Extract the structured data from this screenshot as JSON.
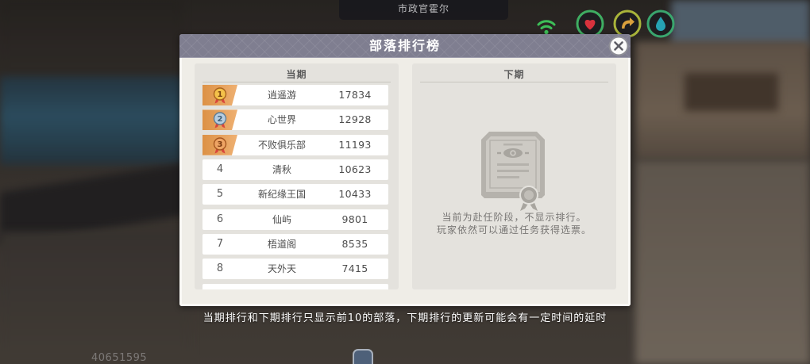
{
  "hud": {
    "npc_label": "市政官霍尔",
    "player_id": "40651595",
    "status_icons": [
      "signal-icon",
      "heart-icon",
      "arrow-icon",
      "water-drop-icon"
    ],
    "bottom_button_icon": "menu-badge-icon"
  },
  "dialog": {
    "title": "部落排行榜",
    "close_icon": "close-icon",
    "current": {
      "header": "当期",
      "rows": [
        {
          "rank": 1,
          "name": "逍遥游",
          "score": 17834
        },
        {
          "rank": 2,
          "name": "心世界",
          "score": 12928
        },
        {
          "rank": 3,
          "name": "不败俱乐部",
          "score": 11193
        },
        {
          "rank": 4,
          "name": "清秋",
          "score": 10623
        },
        {
          "rank": 5,
          "name": "新纪缘王国",
          "score": 10433
        },
        {
          "rank": 6,
          "name": "仙屿",
          "score": 9801
        },
        {
          "rank": 7,
          "name": "梧道阁",
          "score": 8535
        },
        {
          "rank": 8,
          "name": "天外天",
          "score": 7415
        }
      ]
    },
    "next": {
      "header": "下期",
      "empty_icon": "certificate-icon",
      "message": [
        "当前为赴任阶段，不显示排行。",
        "玩家依然可以通过任务获得选票。"
      ]
    }
  },
  "footnote": "当期排行和下期排行只显示前10的部落，下期排行的更新可能会有一定时间的延时",
  "colors": {
    "title_bar": "#7f7e90",
    "panel": "#e4e2dd",
    "medal_tag": "#ea9a4a",
    "medal_gold": "#f4c14a",
    "medal_silver": "#b7cde0",
    "medal_bronze": "#eea464"
  }
}
